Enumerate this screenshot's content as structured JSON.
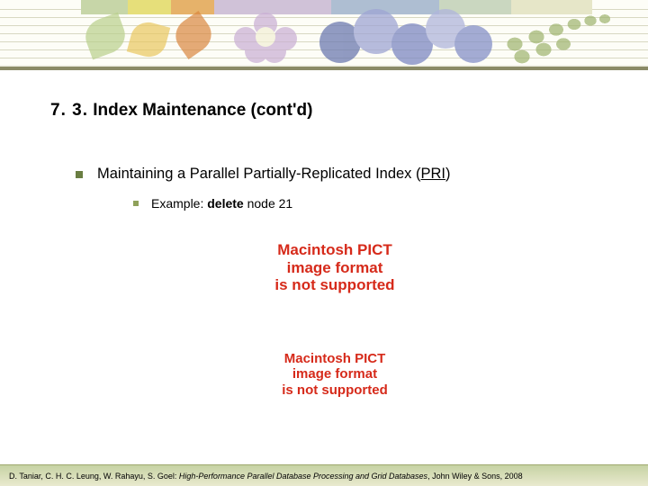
{
  "heading": {
    "number": "7. 3.",
    "title": "Index Maintenance (cont'd)"
  },
  "bullets": {
    "level1_prefix": "Maintaining a Parallel Partially-Replicated Index (",
    "level1_abbrev": "PRI",
    "level1_suffix": ")",
    "level2_prefix": "Example: ",
    "level2_bold": "delete",
    "level2_suffix": " node 21"
  },
  "pict_error": {
    "line1": "Macintosh PICT",
    "line2": "image format",
    "line3": "is not supported"
  },
  "footer": {
    "authors": "D. Taniar, C. H. C. Leung, W. Rahayu, S. Goel: ",
    "title_italic": "High-Performance Parallel Database Processing and Grid Databases",
    "publisher": ", John Wiley & Sons, 2008"
  }
}
